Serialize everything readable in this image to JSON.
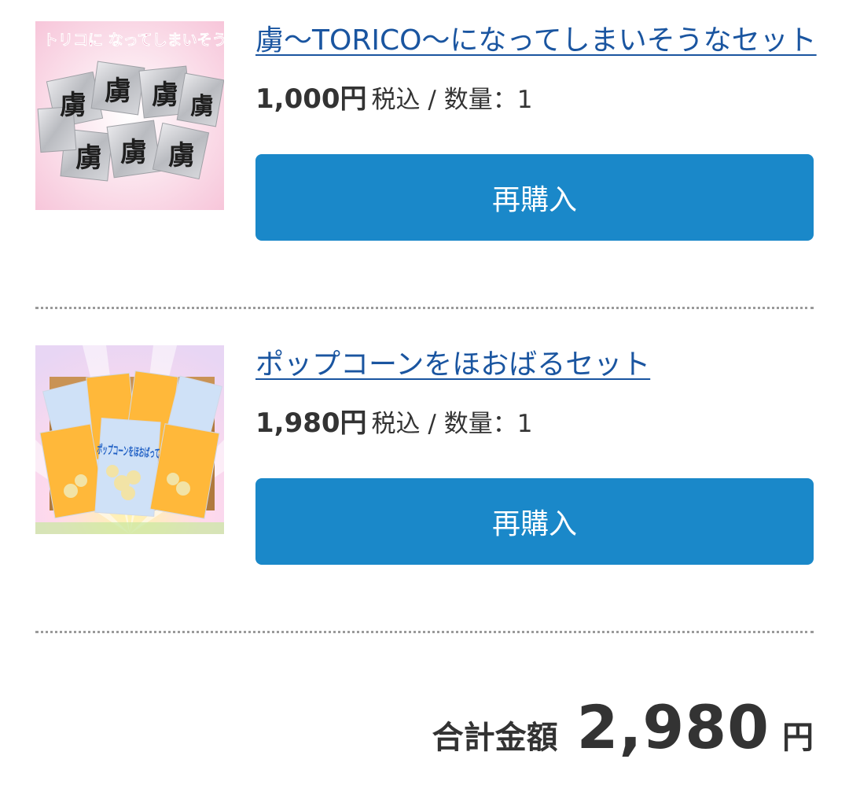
{
  "items": [
    {
      "image_caption": "トリコに なってしまいそう…",
      "image_pack_text": "虜",
      "title": "虜〜TORICO〜になってしまいそうなセット",
      "price": "1,000円",
      "meta": "税込 / 数量：1",
      "button_label": "再購入"
    },
    {
      "image_pack_text": "ポップコーンをほおばって",
      "title": "ポップコーンをほおばるセット",
      "price": "1,980円",
      "meta": "税込 / 数量：1",
      "button_label": "再購入"
    }
  ],
  "total": {
    "label": "合計金額",
    "value": "2,980",
    "unit": "円"
  },
  "colors": {
    "link": "#1a55a0",
    "button": "#1a88c9",
    "text": "#333333",
    "divider": "#9a9a9a"
  }
}
